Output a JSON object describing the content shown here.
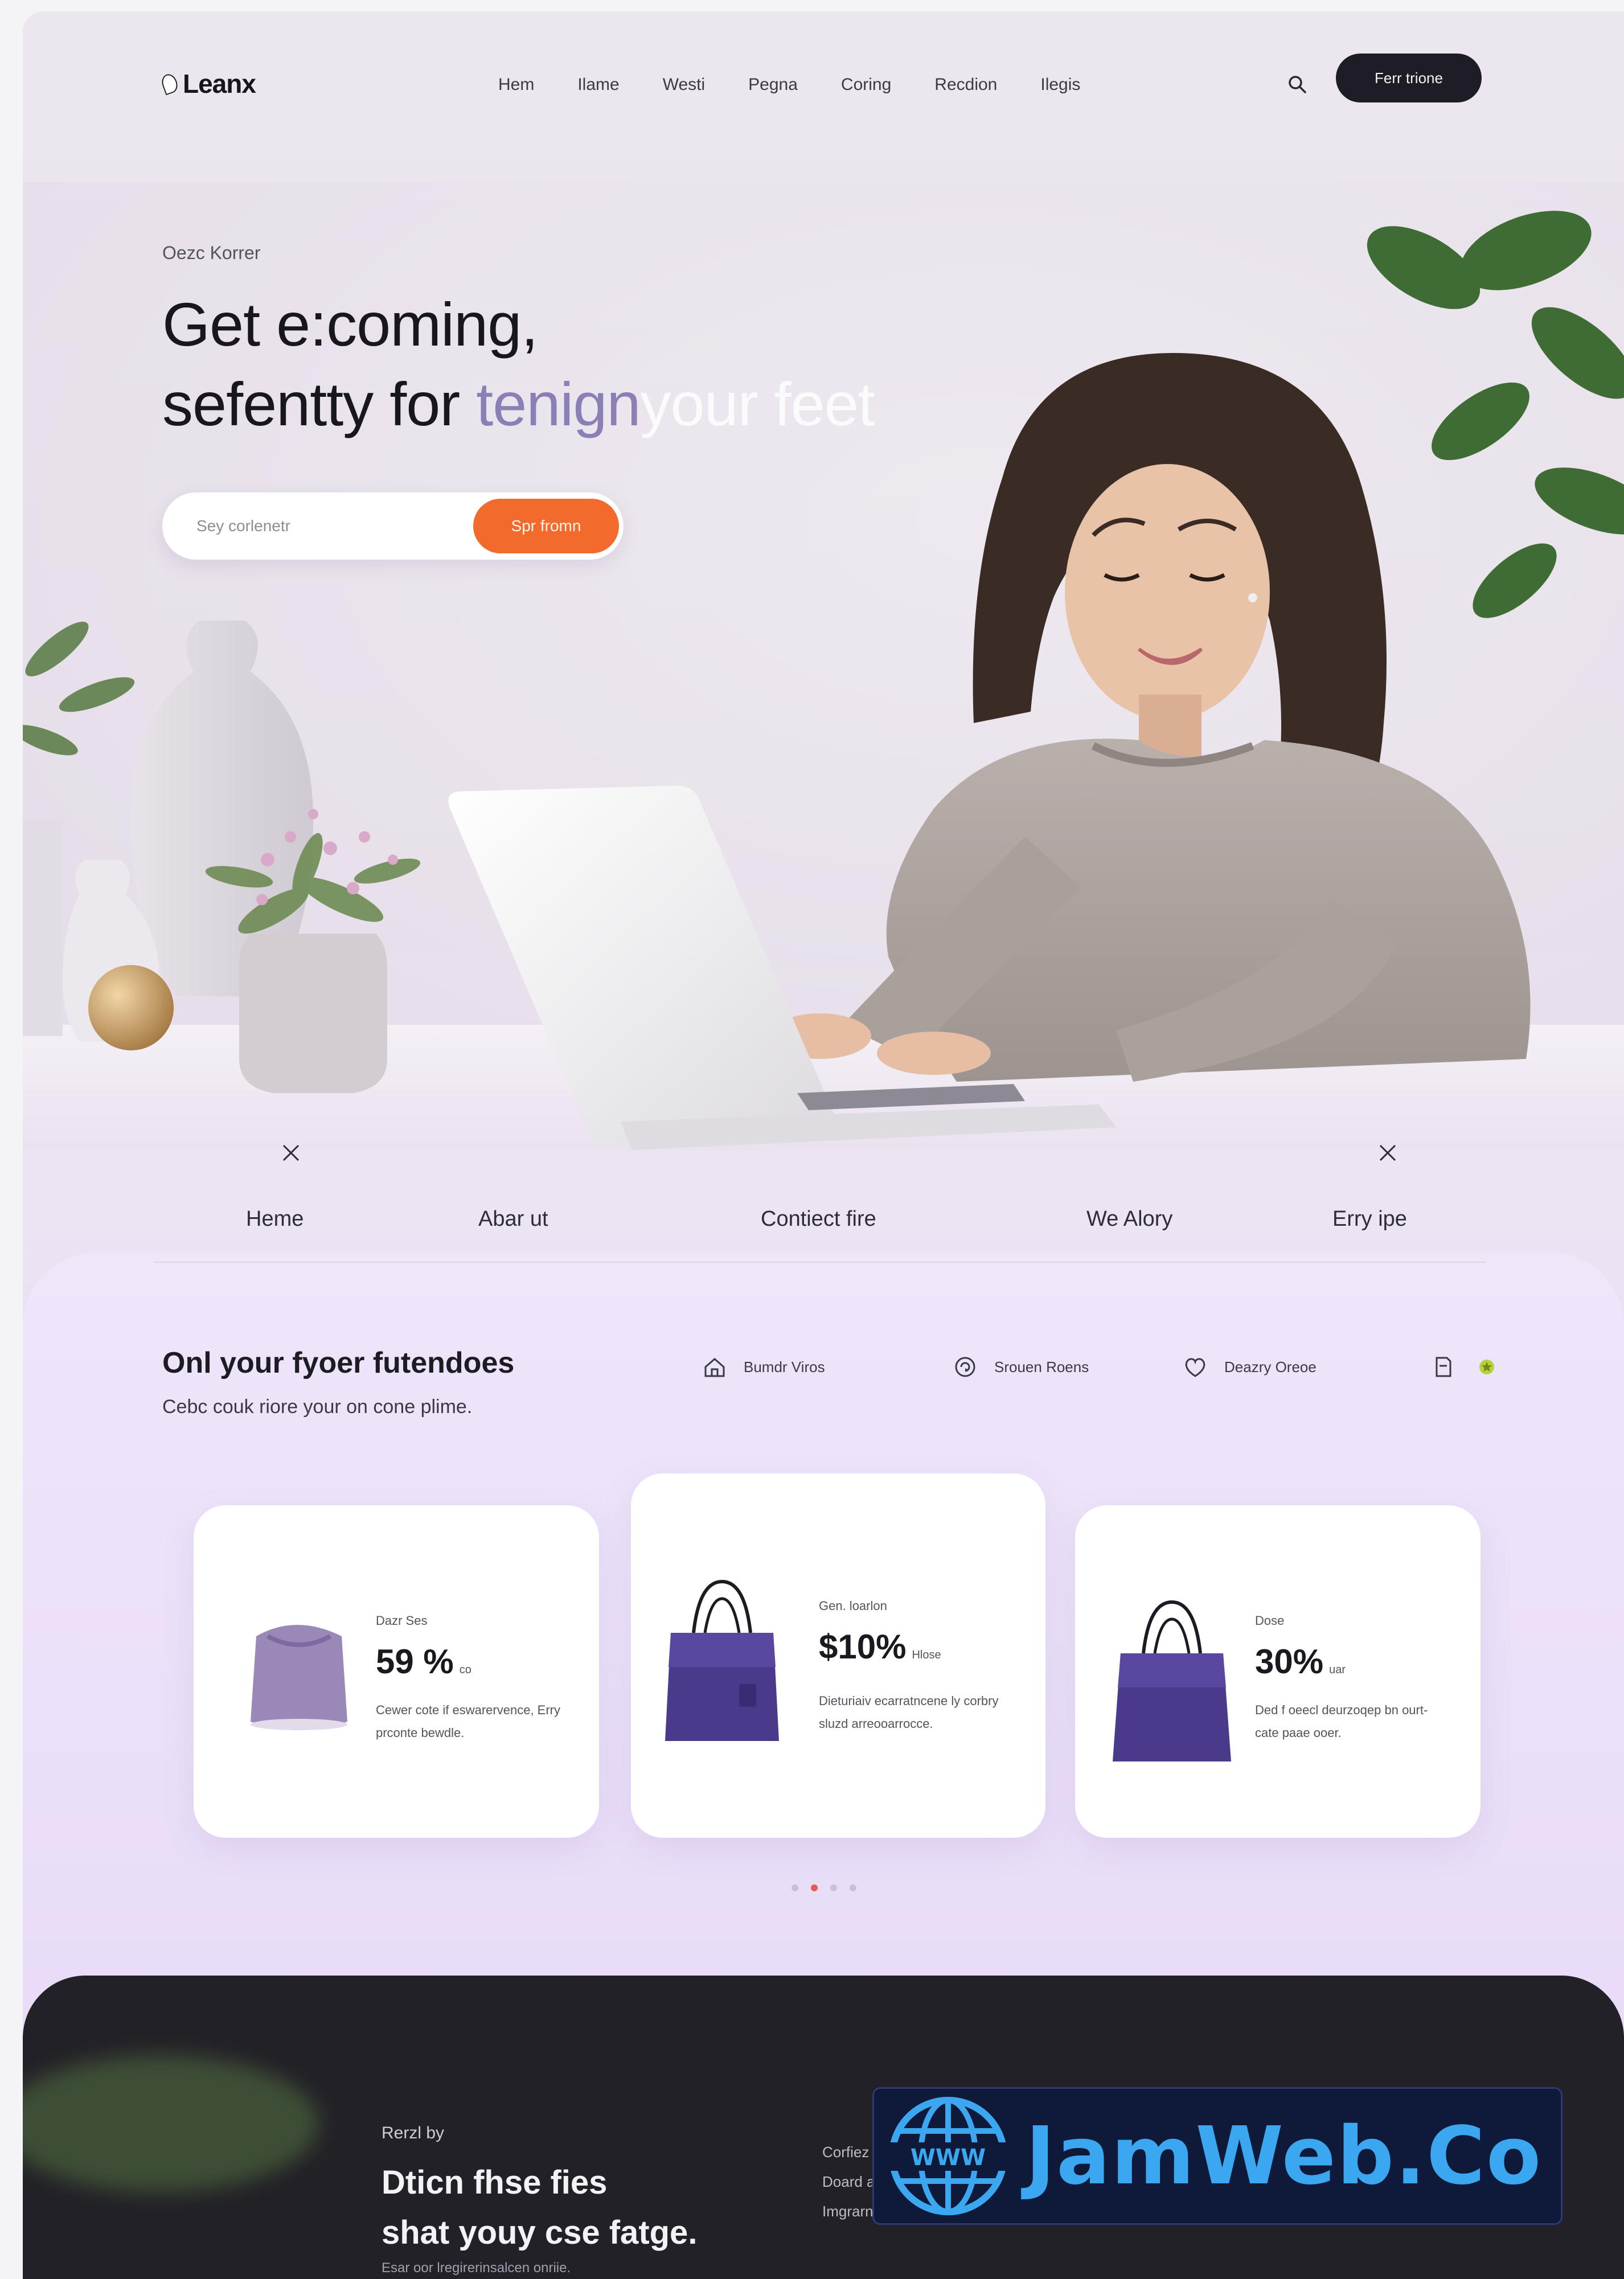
{
  "brand": {
    "name": "Leanx"
  },
  "nav": {
    "links": [
      "Hem",
      "Ilame",
      "Westi",
      "Pegna",
      "Coring",
      "Recdion",
      "Ilegis"
    ],
    "cta_label": "Ferr trione"
  },
  "hero": {
    "eyebrow": "Oezc Korrer",
    "title_line1": "Get e:coming,",
    "title_line2_a": "sefentty for ",
    "title_line2_accent": "tenign",
    "title_line2_fade": "your feet",
    "input_placeholder": "Sey corlenetr",
    "submit_label": "Spr fromn"
  },
  "quick_links": [
    "Heme",
    "Abar ut",
    "Contiect fire",
    "We Alory",
    "Erry ipe"
  ],
  "products": {
    "title": "Onl your fyoer futendoes",
    "subtitle": "Cebc couk riore your on cone plime.",
    "features": [
      {
        "icon": "home-icon",
        "label": "Bumdr Viros"
      },
      {
        "icon": "refresh-icon",
        "label": "Srouen Roens"
      },
      {
        "icon": "heart-icon",
        "label": "Deazry Oreoe"
      }
    ],
    "cards": [
      {
        "eyebrow": "Dazr Ses",
        "value": "59 %",
        "unit": "co",
        "desc": "Cewer cote if eswarervence, Erry prconte bewdle."
      },
      {
        "eyebrow": "Gen. loarlon",
        "value": "$10%",
        "unit": "Hlose",
        "desc": "Dieturiaiv ecarratncene ly corbry sluzd arreooarrocce."
      },
      {
        "eyebrow": "Dose",
        "value": "30%",
        "unit": "uar",
        "desc": "Ded f oeecl deurzoqep bn ourt-cate paae ooer."
      }
    ],
    "pagination": {
      "total": 4,
      "active": 1
    }
  },
  "footer": {
    "eyebrow": "Rerzl by",
    "title_line1": "Dticn fhse fies",
    "title_line2": "shat youy cse fatge.",
    "sub": "Esar oor lregirerinsalcen onriie.",
    "links": [
      "Corfiez l",
      "Doard ar",
      "Imgrarn"
    ]
  },
  "watermark": {
    "text": "JamWeb.Co",
    "globe_label": "WWW"
  },
  "colors": {
    "accent_orange": "#f26a2c",
    "dark": "#1e1c24",
    "lavender": "#e8dcf8",
    "bag_purple": "#4b3a8c",
    "badge_blue": "#3aa7f0"
  }
}
